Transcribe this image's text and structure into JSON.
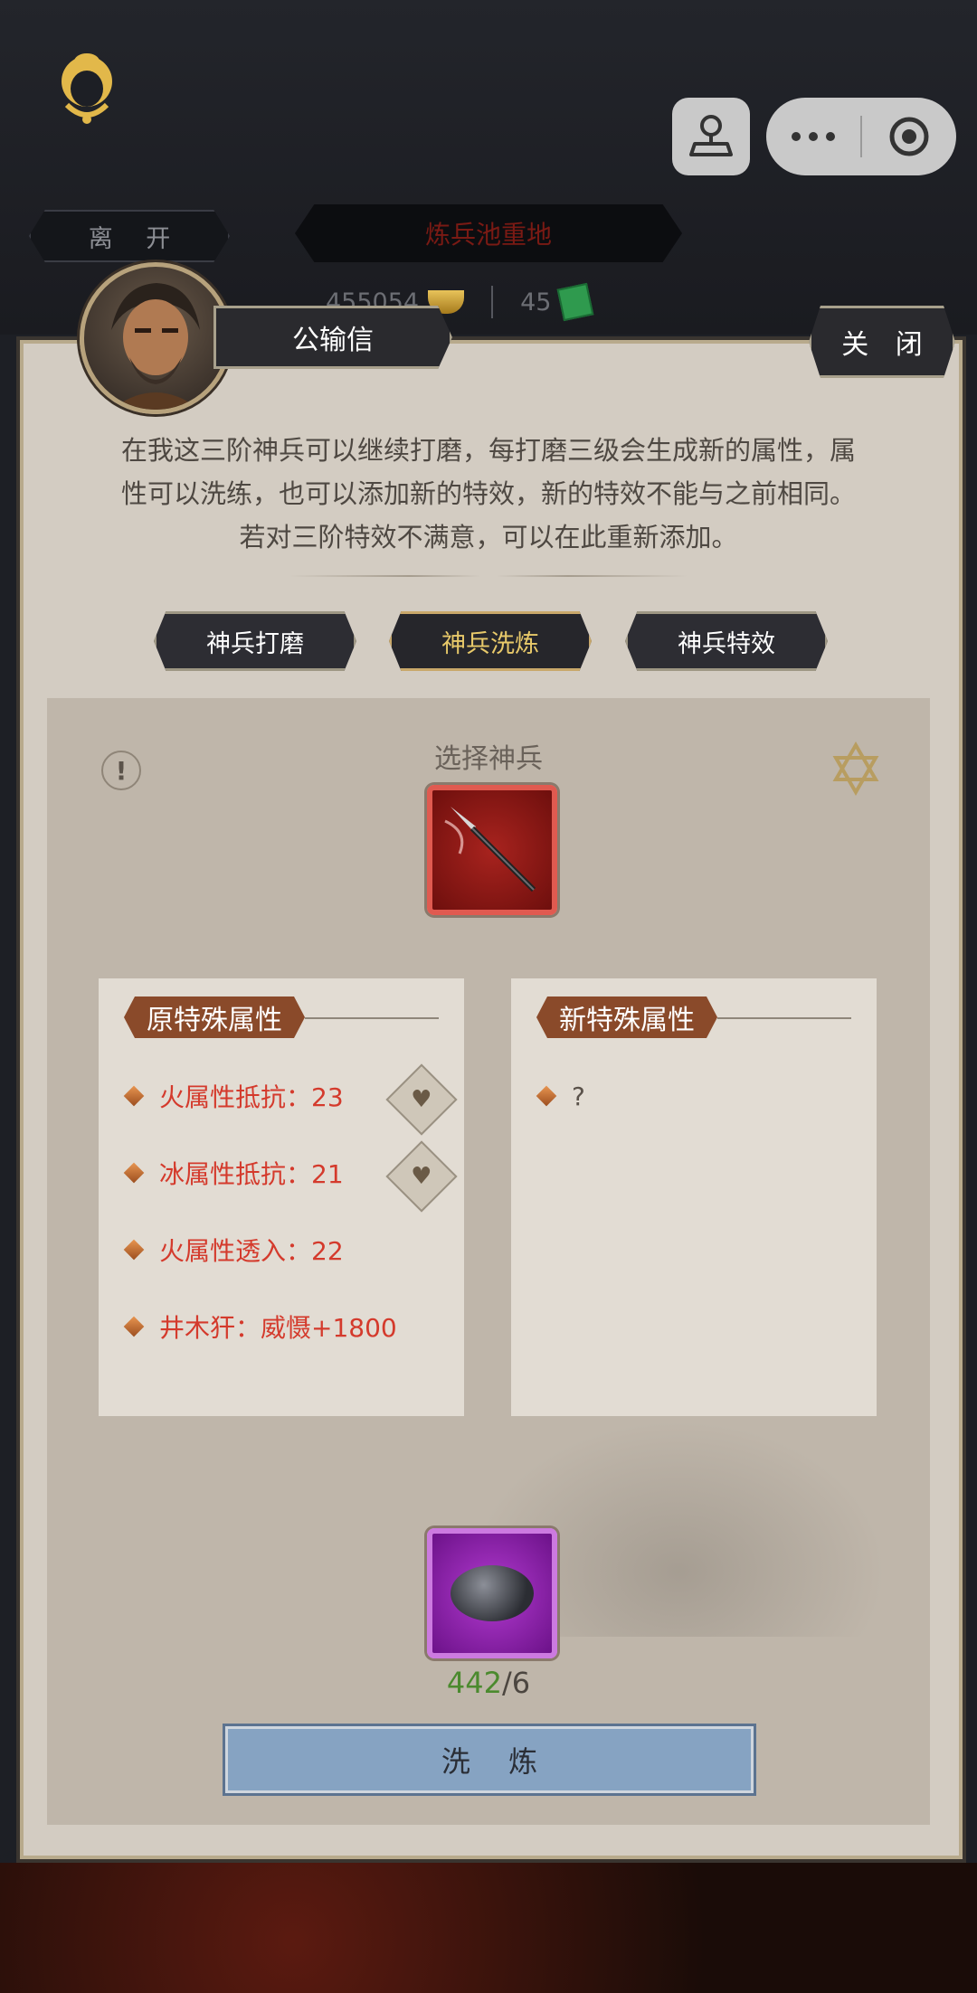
{
  "header": {
    "leave_label": "离 开",
    "location_title": "炼兵池重地",
    "gold_amount": "455054",
    "ticket_amount": "45"
  },
  "npc": {
    "name": "公输信",
    "close_label": "关 闭",
    "description_lines": [
      "在我这三阶神兵可以继续打磨，每打磨三级会生成新的属性，属",
      "性可以洗练，也可以添加新的特效，新的特效不能与之前相同。",
      "若对三阶特效不满意，可以在此重新添加。"
    ]
  },
  "tabs": [
    {
      "label": "神兵打磨",
      "active": false
    },
    {
      "label": "神兵洗炼",
      "active": true
    },
    {
      "label": "神兵特效",
      "active": false
    }
  ],
  "workspace": {
    "select_label": "选择神兵",
    "info_icon": "!",
    "original_title": "原特殊属性",
    "new_title": "新特殊属性",
    "original_attributes": [
      {
        "text": "火属性抵抗：23",
        "lockable": true
      },
      {
        "text": "冰属性抵抗：21",
        "lockable": true
      },
      {
        "text": "火属性透入：22",
        "lockable": false
      },
      {
        "text": "井木犴：威慑+1800",
        "lockable": false
      }
    ],
    "new_attributes": [
      "?"
    ],
    "material_have": "442",
    "material_need": "/6",
    "refine_label": "洗 炼"
  },
  "colors": {
    "attribute_red": "#d43a2c",
    "have_green": "#4b8a2e",
    "refine_blue": "#86a3c2",
    "tab_active_gold": "#e8c96a"
  }
}
